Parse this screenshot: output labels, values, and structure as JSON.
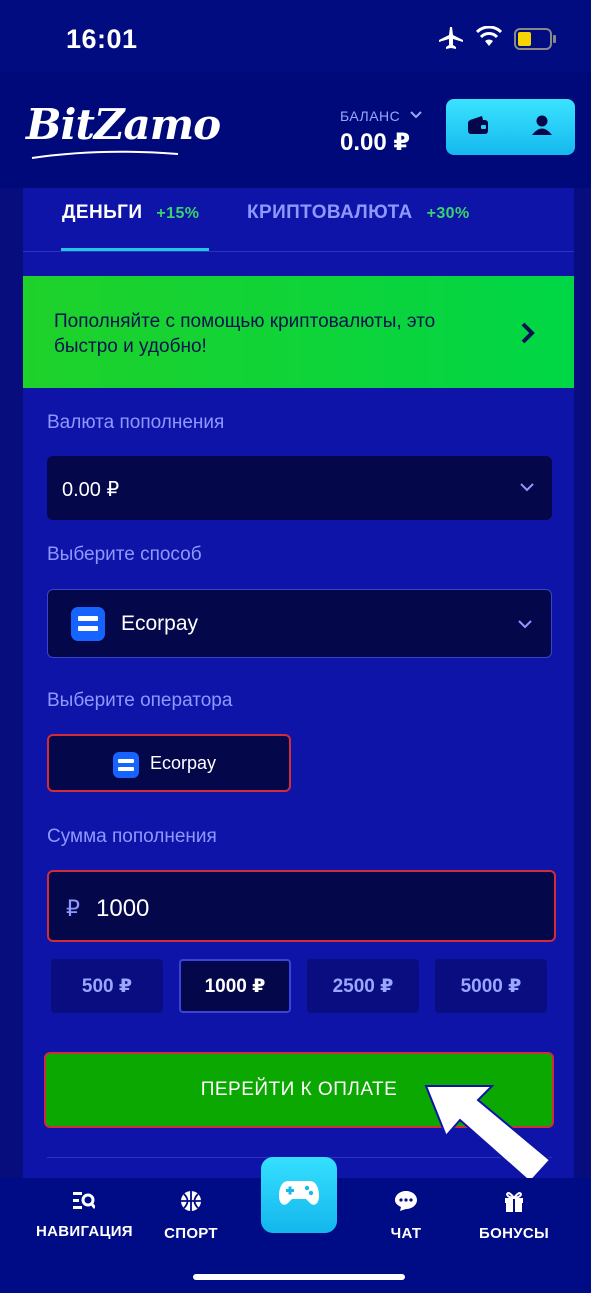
{
  "status_bar": {
    "time": "16:01",
    "icons": [
      "airplane-icon",
      "wifi-icon",
      "battery-icon"
    ]
  },
  "header": {
    "logo": "BitZamo",
    "balance_label": "БАЛАНС",
    "balance_value": "0.00 ₽",
    "buttons": [
      "wallet-icon",
      "user-icon"
    ]
  },
  "tabs": [
    {
      "label": "ДЕНЬГИ",
      "bonus": "+15%",
      "active": true
    },
    {
      "label": "КРИПТОВАЛЮТА",
      "bonus": "+30%",
      "active": false
    }
  ],
  "promo": {
    "text": "Пополняйте с помощью криптовалюты, это быстро и удобно!",
    "icon": "chevron-right-icon"
  },
  "form": {
    "currency_label": "Валюта пополнения",
    "currency_value": "0.00 ₽",
    "method_label": "Выберите способ",
    "method_value": "Ecorpay",
    "operator_label": "Выберите оператора",
    "operator_value": "Ecorpay",
    "amount_label": "Сумма пополнения",
    "amount_currency": "₽",
    "amount_value": "1000",
    "presets": [
      {
        "label": "500 ₽",
        "active": false
      },
      {
        "label": "1000 ₽",
        "active": true
      },
      {
        "label": "2500 ₽",
        "active": false
      },
      {
        "label": "5000 ₽",
        "active": false
      }
    ],
    "submit_label": "ПЕРЕЙТИ К ОПЛАТЕ"
  },
  "bottom_nav": [
    {
      "label": "НАВИГАЦИЯ",
      "icon": "navigation-icon"
    },
    {
      "label": "СПОРТ",
      "icon": "basketball-icon"
    },
    {
      "label": "",
      "icon": "gamepad-icon"
    },
    {
      "label": "ЧАТ",
      "icon": "chat-icon"
    },
    {
      "label": "БОНУСЫ",
      "icon": "gift-icon"
    }
  ],
  "colors": {
    "background": "#000c80",
    "panel": "#0f14a8",
    "accent_cyan": "#22c6e6",
    "promo_green": "#1fd12a",
    "pay_green": "#0aa800",
    "highlight_red": "#d02c3a",
    "bonus_green": "#38d46b"
  }
}
